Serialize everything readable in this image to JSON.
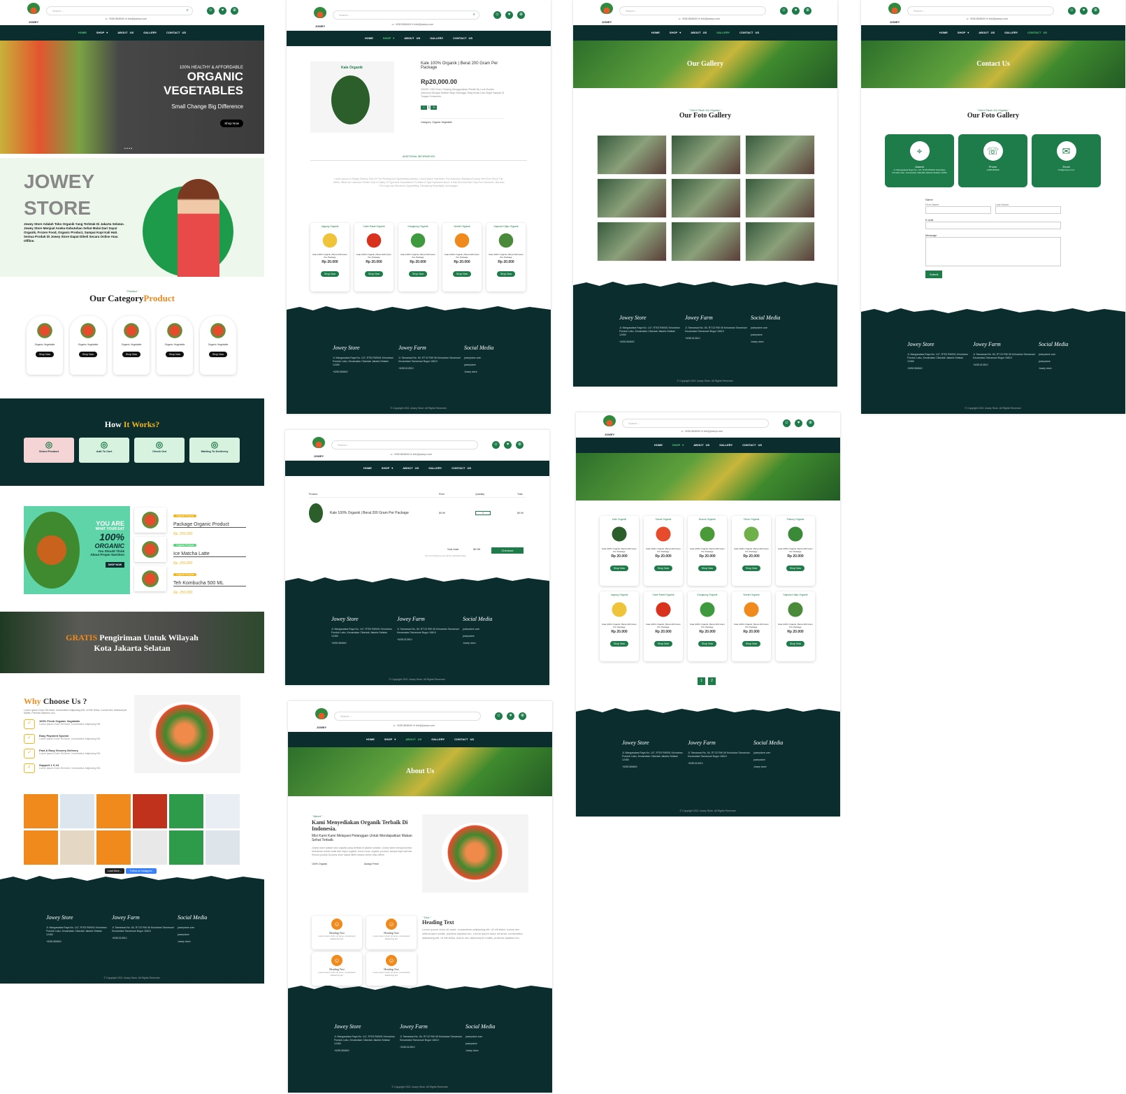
{
  "brand": {
    "logo_text": "JOWEY"
  },
  "header": {
    "search_placeholder": "Search ...",
    "phone": "+6281384840I",
    "email": "info@joweys.com"
  },
  "nav": {
    "home": "HOME",
    "shop": "SHOP ▾",
    "about": "ABOUT US",
    "gallery": "GALLERY",
    "contact": "CONTACT US"
  },
  "home": {
    "hero": {
      "eyebrow": "100% HEALTHY & AFFORDABLE",
      "title1": "ORGANIC",
      "title2": "VEGETABLES",
      "tagline": "Small Change Big Difference",
      "cta": "Shop Now"
    },
    "store": {
      "title1": "JOWEY",
      "title2": "STORE",
      "desc": "Jowey Store Adalah Toko Organik Yang Terletak Di Jakarta Selatan. Jowey Store Menjual Aneka Kebutuhan Sehat Mulai Dari Sayur Organik, Frozen Food, Organic Product, Sampai Kopi Kali Hati. Semua Produk Di Jowey Store Dapat Dibeli Secara Online Atau Offline."
    },
    "category": {
      "eyebrow": "\" Product \"",
      "title_a": "Our Category",
      "title_b": "Product",
      "items": [
        "Organic Vegetable",
        "Organic Vegetable",
        "Organic Vegetable",
        "Organic Vegetable",
        "Organic Vegetable"
      ],
      "btn": "Shop Now"
    },
    "how": {
      "title_a": "How",
      "title_b": "It Works?",
      "steps": [
        "Select Product",
        "Add To Cart",
        "Check Out",
        "Waiting To Deelivery"
      ]
    },
    "promo": {
      "l1": "YOU ARE",
      "l2": "WHAT YOUR EAT",
      "l3": "100%",
      "l4": "ORGANIC",
      "l5": "You Should Think About Proper Nutrition",
      "btn": "SHOP NOW"
    },
    "products": [
      {
        "tag": "Organic Product",
        "name": "Package Organic Product",
        "price": "Rp. 250,000"
      },
      {
        "tag": "Organic Product",
        "name": "Ice Matcha Latte",
        "price": "Rp. 250,000"
      },
      {
        "tag": "Organic Product",
        "name": "Teh Kombucha 500 ML",
        "price": "Rp. 250,000"
      }
    ],
    "free": {
      "a": "GRATIS",
      "b": "Pengiriman Untuk Wilayah",
      "c": "Kota Jakarta Selatan"
    },
    "why": {
      "title_a": "Why",
      "title_b": "Choose Us ?",
      "desc": "Lorem Ipsum Dolor Sit Amet, Consectetur Adipiscing Elit. Ut Elit Tellus, Luctus Nec Ullamcorper Mattis, Pulvinar Dapibus Leo.",
      "items": [
        "100% Fresh Organic Vegetable",
        "Easy Payment System",
        "Fast & Easy Grocery Delivery",
        "Support 1 X 24"
      ],
      "item_desc": "Lorem Ipsum Dolor Sit Amet, Consectetur Adipiscing Elit."
    },
    "ig": {
      "load": "Load More...",
      "follow": "Follow on Instagram"
    }
  },
  "product_detail": {
    "img_label": "Kale Organik",
    "name": "Kale 100% Organik | Berat 200 Gram Per Package",
    "price": "Rp20,000.00",
    "desc": "200GR / 250 Gram, Packing Menggunakan Plastik Zip Lock Double (Vacuum) Dengan Bubble Wrap Sehingga Tetap Aman Dan Segar Sampai Di Tangan Konsumen.",
    "qty": "1",
    "category": "Category: Organic Vegetable",
    "tab": "ADDITIONAL INFORMATION",
    "lorem": "Lorem Ipsum Is Simply Dummy Text Of The Printing And Typesetting Industry. Lorem Ipsum Has Been The Industry's Standard Dummy Text Ever Since The 1500s, When An Unknown Printer Took A Galley Of Type And Scrambled It To Make A Type Specimen Book. It Has Survived Not Only Five Centuries, But Also The Leap Into Electronic Typesetting, Remaining Essentially Unchanged."
  },
  "related": [
    {
      "label": "Jagung Organik",
      "name": "Kale 100% Organik | Berat 200 Gram Per Package",
      "price": "Rp 20.000"
    },
    {
      "label": "Cabe Rawit Organik",
      "name": "Kale 100% Organik | Berat 200 Gram Per Package",
      "price": "Rp 20.000"
    },
    {
      "label": "Kangkung Organik",
      "name": "Kale 100% Organik | Berat 200 Gram Per Package",
      "price": "Rp 20.000"
    },
    {
      "label": "Wortel Organik",
      "name": "Kale 100% Organik | Berat 200 Gram Per Package",
      "price": "Rp 20.000"
    },
    {
      "label": "Sayuran Hijau Organik",
      "name": "Kale 100% Organik | Berat 200 Gram Per Package",
      "price": "Rp 20.000"
    }
  ],
  "cart": {
    "h_product": "Product",
    "h_price": "Price",
    "h_qty": "Quantity",
    "h_total": "Total",
    "item": "Kale 100% Organik | Berat 200 Gram Per Package",
    "price": "$9.99",
    "qty": "1",
    "total": "$9.99",
    "subtotal_label": "Sub-total",
    "subtotal": "$9.99",
    "note": "Tax and shipping cost will be calculated later",
    "checkout": "Checkout"
  },
  "about": {
    "band": "About Us",
    "eyebrow": "\" About \"",
    "title": "Kami Menyediakan Organik Terbaik Di Indonesia.",
    "subtitle": "Misi Kami Kami Melayani Pelanggan Untuk Mendapatkan Makan Sehat Terbaik.",
    "desc": "Jowey store adalah toko organik yang terletak di jakarta selatan. Jowey store menjual aneka kebutuhan sehat mulai dari sayur organik, frozen food, organic product, sampai kopi kali hati. Semua produk di jowey store dapat dibeli secara online atau offline.",
    "f1": "100% Organic",
    "f2": "Always Fresh",
    "f_desc": "Lorem ipsum dolor sit amet consectetur.",
    "heading_card": "Heading Text",
    "card_desc": "Lorem ipsum dolor sit amet, consectetur adipiscing elit.",
    "text_eyebrow": "\" Text \"",
    "text_title": "Heading Text",
    "text_body": "Lorem ipsum dolor sit amet, consectetur adipiscing elit. Ut elit tellus, luctus nec ullamcorper mattis, pulvinar dapibus leo. Lorem ipsum dolor sit amet, consectetur adipiscing elit. Ut elit tellus, luctus nec ullamcorper mattis, pulvinar dapibus leo."
  },
  "gallery": {
    "band": "Our Gallery",
    "eyebrow": "\" Don't Panic Go Organic \"",
    "title": "Our Foto Gallery"
  },
  "contact": {
    "band": "Contact Us",
    "eyebrow": "\" Don't Panic Go Organic \"",
    "title": "Our Foto Gallery",
    "c1": "Alamat",
    "c2": "Phone",
    "c3": "Email",
    "name": "Name",
    "first": "First Name",
    "last": "Last Name",
    "email": "E-mail",
    "message": "Message",
    "submit": "Submit"
  },
  "shop": {
    "labels": [
      "Kale Organik",
      "Tomat Organik",
      "Buncis Organik",
      "Timun Organik",
      "Pakcoy Organik",
      "Jagung Organik",
      "Cabe Rawit Organik",
      "Kangkung Organik",
      "Wortel Organik",
      "Sayuran Hijau Organik"
    ],
    "name": "Kale 100% Organik | Berat 200 Gram Per Package",
    "price": "Rp 20.000",
    "btn": "Shop Now",
    "pages": [
      "1",
      "2"
    ]
  },
  "footer": {
    "c1": "Jowey Store",
    "c2": "Jowey Farm",
    "c3": "Social Media",
    "addr1": "Jl. Mangasatwa Raya No. 147, RT03 RW001 Kelurahan Pondok Labu, Kecamatan Cilandak Jakarta Selatan 12450",
    "addr2": "Jl. Tamansari No. 84, RT 02 RW 06 Kelurahan Tamansari Kecamatan Tamansari Bogor 16610",
    "phone1": "+6281384840",
    "phone2": "+6281312810",
    "s1": "joweystore.com",
    "s2": "joweystore",
    "s3": "Jowey store",
    "copy": "© Copyright 2021 Jowey Store. All Rights Reserved."
  },
  "colors": {
    "primary": "#1e7b4a",
    "dark": "#0b2d2e",
    "accent": "#f08a1c"
  }
}
